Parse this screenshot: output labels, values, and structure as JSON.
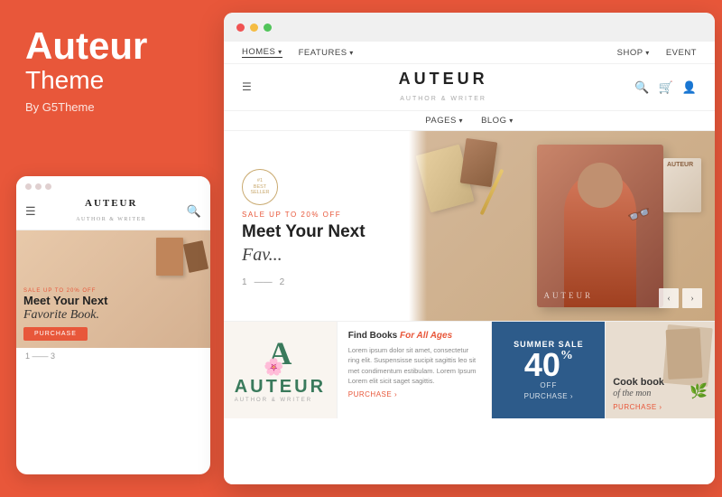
{
  "left": {
    "title_bold": "Auteur",
    "title_light": "Theme",
    "by_line": "By G5Theme",
    "mobile_dots_colors": [
      "#e0e0e0",
      "#e0e0e0",
      "#e0e0e0"
    ],
    "mobile_logo": "AUTEUR",
    "mobile_logo_sub": "AUTHOR & WRITER",
    "mobile_sale": "SALE UP TO 20% OFF",
    "mobile_hero_title": "Meet Your Next",
    "mobile_hero_italic": "Favorite Book.",
    "mobile_btn": "PURCHASE",
    "mobile_pagination_start": "1",
    "mobile_pagination_end": "3"
  },
  "browser": {
    "dots": [
      {
        "color": "#f05353"
      },
      {
        "color": "#f5bc42"
      },
      {
        "color": "#51c45a"
      }
    ],
    "top_nav": [
      {
        "label": "HOMES",
        "active": true,
        "arrow": true
      },
      {
        "label": "FEATURES",
        "active": false,
        "arrow": true
      },
      {
        "label": "SHOP",
        "active": false,
        "arrow": true
      },
      {
        "label": "EVENT",
        "active": false
      }
    ],
    "logo": "AUTEUR",
    "logo_sub": "AUTHOR & WRITER",
    "secondary_nav": [
      {
        "label": "PAGES",
        "arrow": true
      },
      {
        "label": "BLOG",
        "arrow": true
      }
    ],
    "hero": {
      "award_line1": "#1",
      "award_line2": "BEST",
      "award_line3": "SELLER",
      "sale_label": "SALE UP TO 20% OFF",
      "title_line1": "Meet Your Ne",
      "title_line2": "xt",
      "italic_text": "Fav...",
      "pagination": {
        "current": "1",
        "separator": "—",
        "total": "2"
      }
    },
    "cards": [
      {
        "type": "auteur",
        "logo": "AUTEUR",
        "sub": "AUTHOR & WRITER",
        "link": ""
      },
      {
        "type": "books",
        "title_prefix": "Find Books ",
        "title_italic": "For All Ages",
        "text": "Lorem ipsum dolor sit amet, consectetur ring elit. Suspensisse sucipit sagittis leo sit met condimentum estibulam. Lorem Ipsum Lorem elit sicit saget sagittis.",
        "link": "PURCHASE ›"
      },
      {
        "type": "sale",
        "top_label": "SUMMER SALE",
        "number": "40",
        "percent": "%",
        "off": "OFF",
        "link": "PURCHASE ›"
      },
      {
        "type": "cookbook",
        "title": "Cook book",
        "italic": "of the mon",
        "link": "PURCHASE ›"
      }
    ]
  }
}
